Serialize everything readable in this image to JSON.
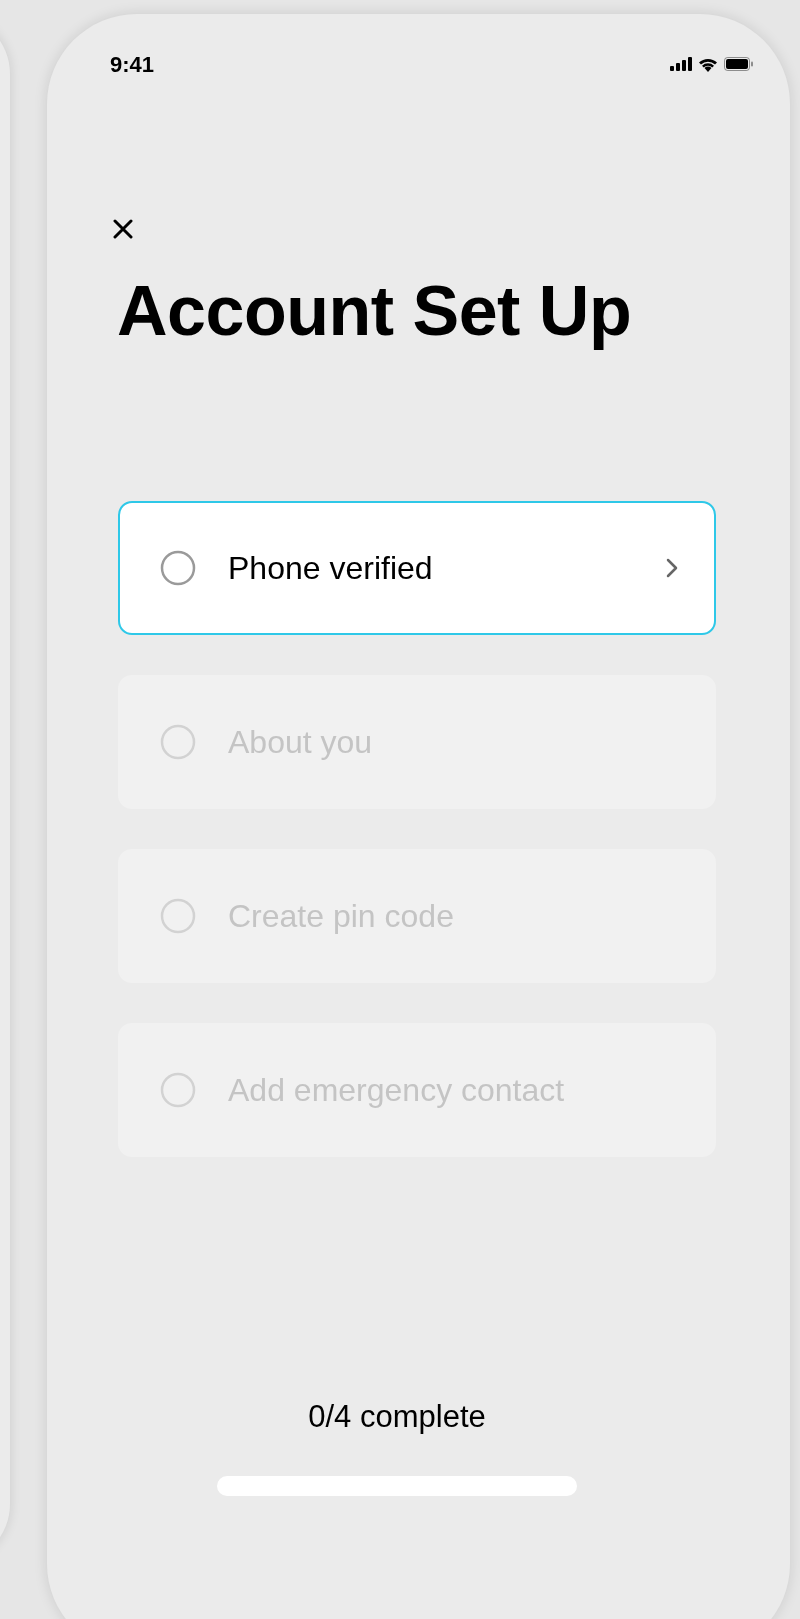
{
  "status_bar": {
    "time": "9:41"
  },
  "title": "Account Set Up",
  "steps": [
    {
      "label": "Phone verified",
      "checked": false,
      "active": true
    },
    {
      "label": "About you",
      "checked": false,
      "active": false
    },
    {
      "label": "Create pin code",
      "checked": false,
      "active": false
    },
    {
      "label": "Add emergency contact",
      "checked": false,
      "active": false
    }
  ],
  "progress": "0/4 complete"
}
